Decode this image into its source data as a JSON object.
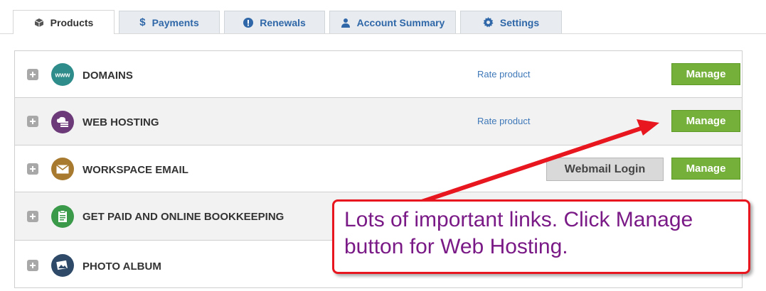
{
  "tabs": [
    {
      "label": "Products",
      "icon": "cube-icon",
      "active": true
    },
    {
      "label": "Payments",
      "icon": "dollar-icon"
    },
    {
      "label": "Renewals",
      "icon": "alert-icon"
    },
    {
      "label": "Account Summary",
      "icon": "person-icon"
    },
    {
      "label": "Settings",
      "icon": "gear-icon"
    }
  ],
  "products": [
    {
      "name": "DOMAINS",
      "icon": "www-icon",
      "icon_color": "#2e8c8a",
      "rate_link": "Rate product",
      "manage_label": "Manage"
    },
    {
      "name": "WEB HOSTING",
      "icon": "hosting-icon",
      "icon_color": "#6c3a78",
      "rate_link": "Rate product",
      "manage_label": "Manage"
    },
    {
      "name": "WORKSPACE EMAIL",
      "icon": "envelope-icon",
      "icon_color": "#a77a2f",
      "webmail_label": "Webmail Login",
      "manage_label": "Manage"
    },
    {
      "name": "GET PAID AND ONLINE BOOKKEEPING",
      "icon": "clipboard-icon",
      "icon_color": "#3a9a4a"
    },
    {
      "name": "PHOTO ALBUM",
      "icon": "photo-icon",
      "icon_color": "#2e4a68"
    }
  ],
  "annotation": {
    "text": "Lots of important links.  Click Manage button for Web Hosting.",
    "border_color": "#e8161e",
    "text_color": "#7a1a86"
  },
  "colors": {
    "manage_green": "#75b03a",
    "link_blue": "#3e78b8"
  }
}
